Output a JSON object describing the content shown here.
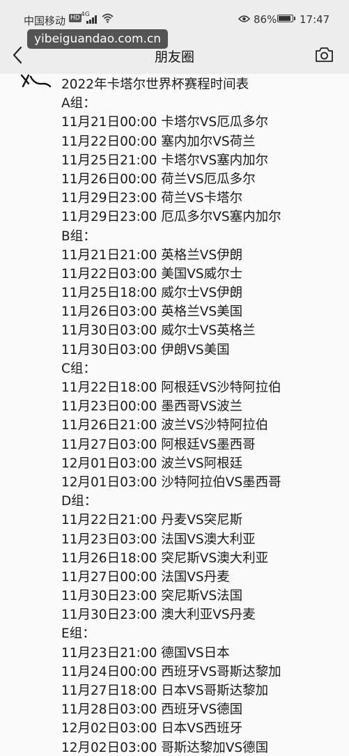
{
  "status_bar": {
    "carrier": "中国移动",
    "network_badge": "HD",
    "network_type": "4G",
    "battery_percent": "86%",
    "time": "17:47"
  },
  "nav": {
    "title": "朋友圈"
  },
  "watermark": "yibeiguandao.com.cn",
  "post": {
    "lines": [
      "2022年卡塔尔世界杯赛程时间表",
      "A组：",
      "11月21日00:00 卡塔尔VS厄瓜多尔",
      "11月22日00:00 塞内加尔VS荷兰",
      "11月25日21:00 卡塔尔VS塞内加尔",
      "11月26日00:00 荷兰VS厄瓜多尔",
      "11月29日23:00 荷兰VS卡塔尔",
      "11月29日23:00 厄瓜多尔VS塞内加尔",
      "B组：",
      "11月21日21:00 英格兰VS伊朗",
      "11月22日03:00 美国VS威尔士",
      "11月25日18:00 威尔士VS伊朗",
      "11月26日03:00 英格兰VS美国",
      "11月30日03:00 威尔士VS英格兰",
      "11月30日03:00 伊朗VS美国",
      "C组：",
      "11月22日18:00 阿根廷VS沙特阿拉伯",
      "11月23日00:00 墨西哥VS波兰",
      "11月26日21:00 波兰VS沙特阿拉伯",
      "11月27日03:00 阿根廷VS墨西哥",
      "12月01日03:00 波兰VS阿根廷",
      "12月01日03:00 沙特阿拉伯VS墨西哥",
      "D组：",
      "11月22日21:00 丹麦VS突尼斯",
      "11月23日03:00 法国VS澳大利亚",
      "11月26日18:00 突尼斯VS澳大利亚",
      "11月27日00:00 法国VS丹麦",
      "11月30日23:00 突尼斯VS法国",
      "11月30日23:00 澳大利亚VS丹麦",
      "E组：",
      "11月23日21:00 德国VS日本",
      "11月24日00:00 西班牙VS哥斯达黎加",
      "11月27日18:00 日本VS哥斯达黎加",
      "11月28日03:00 西班牙VS德国",
      "12月02日03:00 日本VS西班牙",
      "12月02日03:00 哥斯达黎加VS德国"
    ]
  },
  "icons": {
    "back": "chevron-left-icon",
    "camera": "camera-icon",
    "wifi": "wifi-icon",
    "signal": "signal-icon",
    "eye": "eye-icon",
    "battery": "battery-icon"
  }
}
